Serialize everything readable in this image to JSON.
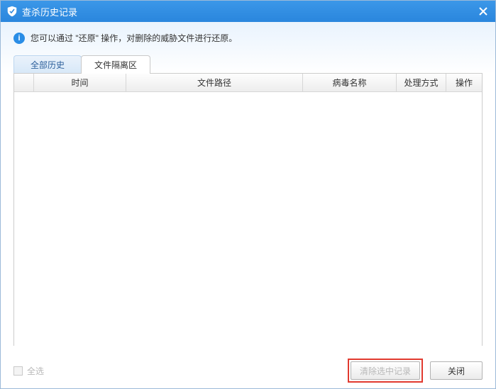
{
  "window": {
    "title": "查杀历史记录"
  },
  "info": {
    "text": "您可以通过 \"还原\" 操作，对删除的威胁文件进行还原。"
  },
  "tabs": [
    {
      "label": "全部历史",
      "active": false
    },
    {
      "label": "文件隔离区",
      "active": true
    }
  ],
  "columns": {
    "time": "时间",
    "path": "文件路径",
    "virus": "病毒名称",
    "method": "处理方式",
    "action": "操作"
  },
  "footer": {
    "select_all": "全选",
    "clear_selected": "清除选中记录",
    "close": "关闭"
  }
}
